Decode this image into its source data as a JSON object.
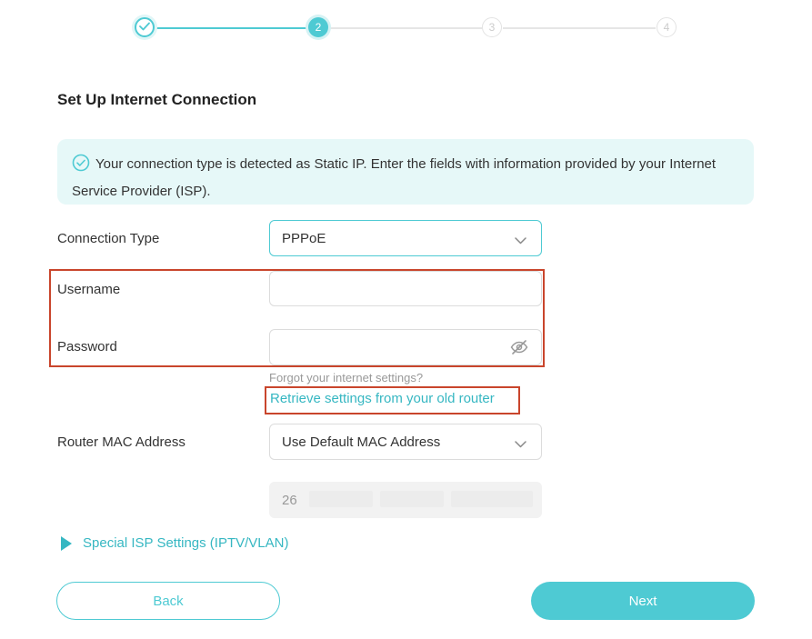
{
  "stepper": {
    "steps": [
      {
        "label": "",
        "state": "done",
        "icon": "check-icon"
      },
      {
        "label": "2",
        "state": "active"
      },
      {
        "label": "3",
        "state": "todo"
      },
      {
        "label": "4",
        "state": "todo"
      }
    ]
  },
  "page": {
    "title": "Set Up Internet Connection"
  },
  "notice": {
    "icon": "check-circle-icon",
    "text": "Your connection type is detected as Static IP. Enter the fields with information provided by your Internet Service Provider (ISP)."
  },
  "form": {
    "connection_type": {
      "label": "Connection Type",
      "value": "PPPoE"
    },
    "username": {
      "label": "Username",
      "value": ""
    },
    "password": {
      "label": "Password",
      "value": "",
      "toggle_icon": "eye-off-icon"
    },
    "forgot_hint": "Forgot your internet settings?",
    "retrieve_link": "Retrieve settings from your old router",
    "mac": {
      "label": "Router MAC Address",
      "value": "Use Default MAC Address",
      "address_prefix": "26"
    }
  },
  "special_isp": {
    "label": "Special ISP Settings (IPTV/VLAN)"
  },
  "buttons": {
    "back": "Back",
    "next": "Next"
  },
  "colors": {
    "accent": "#4ecad3",
    "link": "#36b7c2",
    "highlight": "#c9452c",
    "notice_bg": "#e6f8f8"
  }
}
